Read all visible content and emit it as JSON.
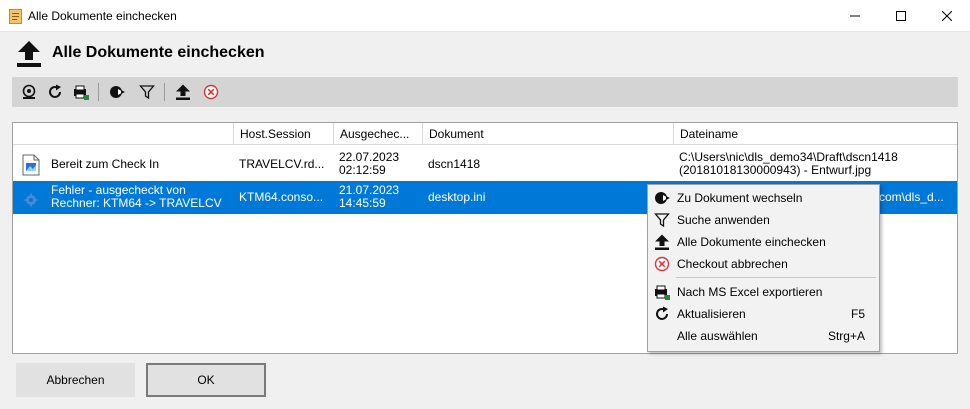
{
  "window": {
    "title": "Alle Dokumente einchecken"
  },
  "header": {
    "title": "Alle Dokumente einchecken"
  },
  "toolbar": {
    "buttons": [
      "open-icon",
      "refresh-icon",
      "excel-export-icon",
      "goto-document-icon",
      "filter-icon",
      "checkin-all-icon",
      "cancel-checkout-icon"
    ]
  },
  "grid": {
    "columns": [
      "",
      "Host.Session",
      "Ausgechec...",
      "Dokument",
      "Dateiname"
    ],
    "rows": [
      {
        "status_line1": "Bereit zum Check In",
        "status_line2": "",
        "host": "TRAVELCV.rd...",
        "date": "22.07.2023",
        "time": "02:12:59",
        "document": "dscn1418",
        "filename_line1": "C:\\Users\\nic\\dls_demo34\\Draft\\dscn1418",
        "filename_line2": "(20181018130000943) - Entwurf.jpg"
      },
      {
        "status_line1": "Fehler - ausgecheckt von",
        "status_line2": "Rechner: KTM64 -> TRAVELCV",
        "host": "KTM64.conso...",
        "date": "21.07.2023",
        "time": "14:45:59",
        "document": "desktop.ini",
        "filename_tail": "com\\dls_d..."
      }
    ]
  },
  "context_menu": {
    "items": [
      {
        "label": "Zu Dokument wechseln",
        "icon": "goto-document-icon",
        "shortcut": ""
      },
      {
        "label": "Suche anwenden",
        "icon": "filter-icon",
        "shortcut": ""
      },
      {
        "label": "Alle Dokumente einchecken",
        "icon": "checkin-all-icon",
        "shortcut": ""
      },
      {
        "label": "Checkout abbrechen",
        "icon": "cancel-checkout-icon",
        "shortcut": ""
      },
      {
        "label": "Nach MS Excel exportieren",
        "icon": "excel-export-icon",
        "shortcut": ""
      },
      {
        "label": "Aktualisieren",
        "icon": "refresh-icon",
        "shortcut": "F5"
      },
      {
        "label": "Alle auswählen",
        "icon": "",
        "shortcut": "Strg+A"
      }
    ]
  },
  "buttons": {
    "cancel": "Abbrechen",
    "ok": "OK"
  },
  "colors": {
    "selection": "#0078d7",
    "toolbar": "#d4d4d4",
    "cancel_red": "#e03030"
  }
}
